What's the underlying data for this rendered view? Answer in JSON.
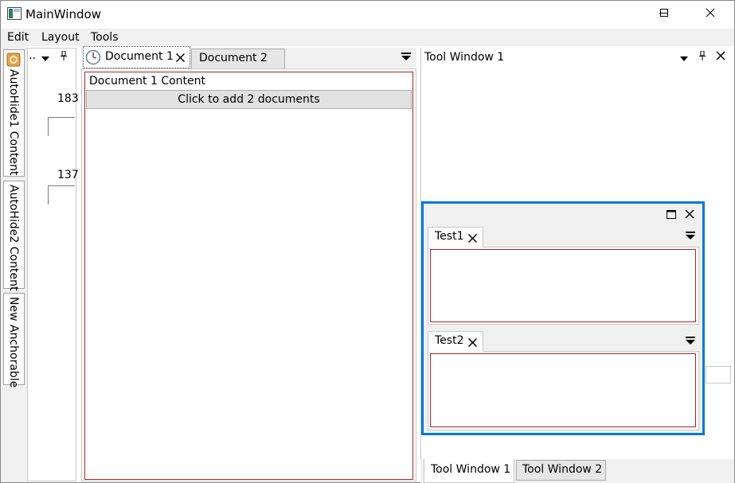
{
  "window": {
    "title": "MainWindow",
    "minimize_icon": "minimize-icon",
    "maximize_icon": "maximize-icon",
    "close_icon": "close-icon"
  },
  "menu": {
    "items": [
      "Edit",
      "Layout",
      "Tools"
    ]
  },
  "autohide": {
    "tabs": [
      "AutoHide1 Content",
      "AutoHide2 Content",
      "New Anchorable"
    ],
    "panel_header": "..",
    "values": [
      "183",
      "137"
    ]
  },
  "documents": {
    "tabs": [
      "Document 1",
      "Document 2"
    ],
    "content_label": "Document 1 Content",
    "button_label": "Click to add 2 documents"
  },
  "tool_window": {
    "title": "Tool Window 1",
    "bottom_tabs": [
      "Tool Window 1",
      "Tool Window 2"
    ]
  },
  "floating": {
    "tabs": [
      "Test1",
      "Test2"
    ]
  },
  "colors": {
    "accent": "#0078d7",
    "content_border": "#b22222",
    "chrome": "#f0f0f0"
  }
}
